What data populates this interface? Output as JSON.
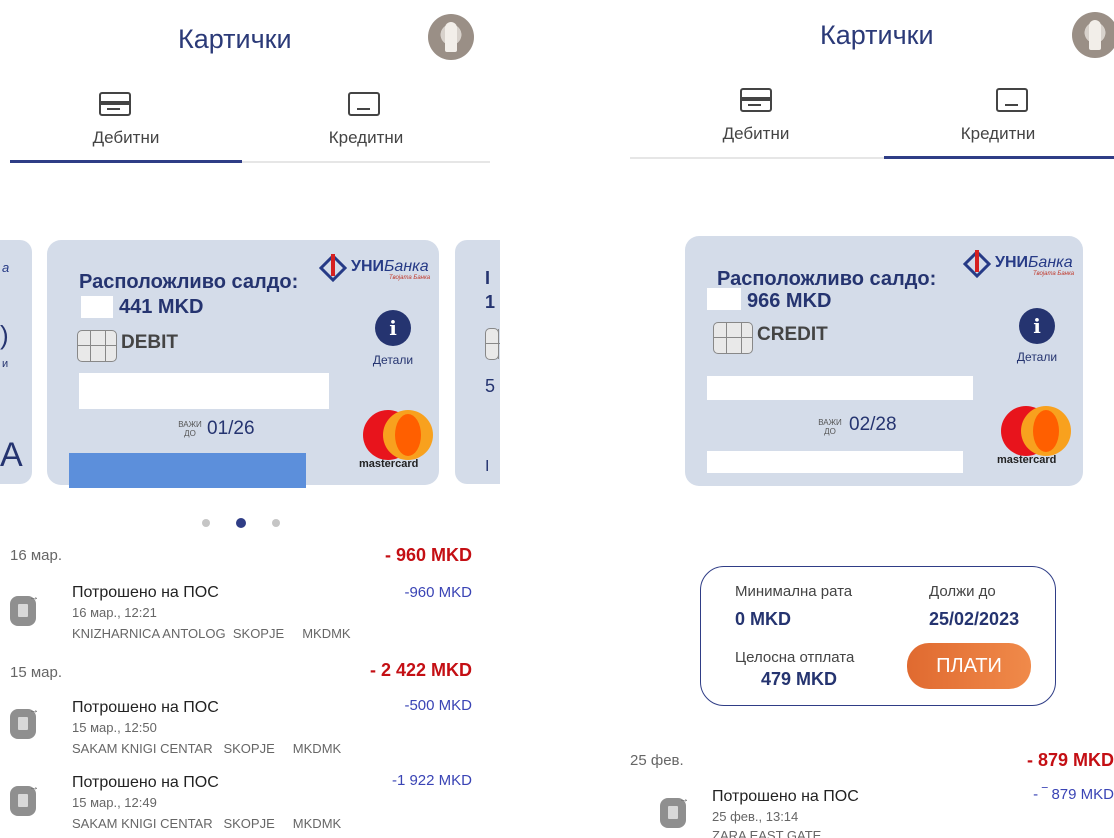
{
  "colors": {
    "primary": "#2f3d86",
    "negative": "#c40f14",
    "tx_blue": "#3a44b5",
    "pay_orange": "#e8733a",
    "card_bg": "#d4dce9"
  },
  "left": {
    "title": "Картички",
    "tabs": [
      {
        "label": "Дебитни",
        "icon": "debit-card-icon",
        "active": true
      },
      {
        "label": "Кредитни",
        "icon": "credit-card-icon",
        "active": false
      }
    ],
    "prev_card": {
      "logo_fragment": "а",
      "number_fragment": ")",
      "details_fragment": "и",
      "bottom_fragment": "A"
    },
    "card": {
      "bank_name": "УНИ",
      "bank_name_italic": "Банка",
      "bank_tagline": "Твојата Банка",
      "saldo_label": "Расположливо салдо:",
      "amount": "441 MKD",
      "type": "DEBIT",
      "details_label": "Детали",
      "valid_label_1": "ВАЖИ",
      "valid_label_2": "ДО",
      "valid_date": "01/26",
      "network": "mastercard"
    },
    "next_card": {
      "saldo_fragment": "I",
      "amount_fragment": "1",
      "number_fragment": "5",
      "bottom_fragment": "I"
    },
    "pager": {
      "count": 3,
      "active": 1
    },
    "transactions": [
      {
        "date": "16 мар.",
        "total": "- 960 MKD",
        "items": [
          {
            "title": "Потрошено на ПОС",
            "time": "16 мар., 12:21",
            "merchant": "KNIZHARNICA ANTOLOG  SKOPJE     MKDMK",
            "amount": "-960 MKD"
          }
        ]
      },
      {
        "date": "15 мар.",
        "total": "- 2 422 MKD",
        "items": [
          {
            "title": "Потрошено на ПОС",
            "time": "15 мар., 12:50",
            "merchant": "SAKAM KNIGI CENTAR   SKOPJE     MKDMK",
            "amount": "-500 MKD"
          },
          {
            "title": "Потрошено на ПОС",
            "time": "15 мар., 12:49",
            "merchant": "SAKAM KNIGI CENTAR   SKOPJE     MKDMK",
            "amount": "-1 922 MKD"
          }
        ]
      }
    ]
  },
  "right": {
    "title": "Картички",
    "tabs": [
      {
        "label": "Дебитни",
        "icon": "debit-card-icon",
        "active": false
      },
      {
        "label": "Кредитни",
        "icon": "credit-card-icon",
        "active": true
      }
    ],
    "card": {
      "bank_name": "УНИ",
      "bank_name_italic": "Банка",
      "bank_tagline": "Твојата Банка",
      "saldo_label": "Расположливо салдо:",
      "amount": "966 MKD",
      "type": "CREDIT",
      "details_label": "Детали",
      "valid_label_1": "ВАЖИ",
      "valid_label_2": "ДО",
      "valid_date": "02/28",
      "network": "mastercard"
    },
    "summary": {
      "min_rate_label": "Минимална рата",
      "min_rate_value": "0 MKD",
      "due_label": "Должи до",
      "due_value": "25/02/2023",
      "full_label": "Целосна отплата",
      "full_value": "479 MKD",
      "pay_button": "ПЛАТИ"
    },
    "transactions": [
      {
        "date": "25 фев.",
        "total": "-   879 MKD",
        "items": [
          {
            "title": "Потрошено на ПОС",
            "time": "25 фев., 13:14",
            "merchant": "ZARA EAST GATE",
            "amount": "- ‾ 879 MKD"
          }
        ]
      }
    ]
  }
}
